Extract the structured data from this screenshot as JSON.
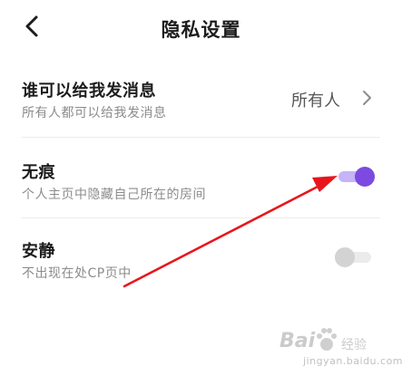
{
  "header": {
    "back_icon": "chevron-left-icon",
    "title": "隐私设置"
  },
  "settings": {
    "message": {
      "title": "谁可以给我发消息",
      "desc": "所有人都可以给我发消息",
      "value": "所有人",
      "icon": "chevron-right-icon"
    },
    "invisible": {
      "title": "无痕",
      "desc": "个人主页中隐藏自己所在的房间",
      "enabled": true
    },
    "quiet": {
      "title": "安静",
      "desc": "不出现在处CP页中",
      "enabled": false
    }
  },
  "colors": {
    "toggle_on_knob": "#7c4ae0",
    "toggle_on_track": "#c6b3f8",
    "toggle_off_knob": "#d3d3d3",
    "toggle_off_track": "#ebebeb",
    "annotation_arrow": "#e8161c"
  },
  "watermark": {
    "logo": "Bai",
    "suffix": "经验",
    "url": "jingyan.baidu.com"
  }
}
